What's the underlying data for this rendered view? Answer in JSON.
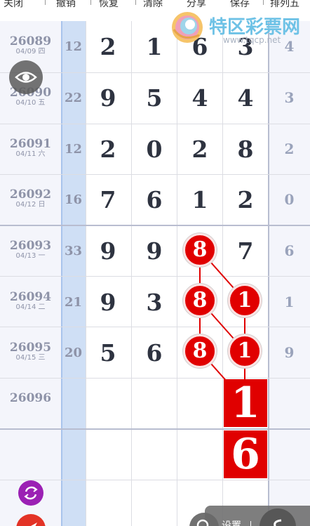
{
  "toolbar": {
    "close": "关闭",
    "undo": "撤销",
    "restore": "恢复",
    "clear": "清除",
    "share": "分享",
    "save": "保存",
    "mode": "排列五"
  },
  "watermark": {
    "brand": "特区彩票网",
    "url": "www.tqcp.net"
  },
  "rows": [
    {
      "issue": "26089",
      "date": "04/09 四",
      "sum": "12",
      "digits": [
        "2",
        "1",
        "6",
        "3"
      ],
      "span": "4"
    },
    {
      "issue": "26090",
      "date": "04/10 五",
      "sum": "22",
      "digits": [
        "9",
        "5",
        "4",
        "4"
      ],
      "span": "3"
    },
    {
      "issue": "26091",
      "date": "04/11 六",
      "sum": "12",
      "digits": [
        "2",
        "0",
        "2",
        "8"
      ],
      "span": "2"
    },
    {
      "issue": "26092",
      "date": "04/12 日",
      "sum": "16",
      "digits": [
        "7",
        "6",
        "1",
        "2"
      ],
      "span": "0"
    },
    {
      "issue": "26093",
      "date": "04/13 一",
      "sum": "33",
      "digits": [
        "9",
        "9",
        "8",
        "7"
      ],
      "span": "6"
    },
    {
      "issue": "26094",
      "date": "04/14 二",
      "sum": "21",
      "digits": [
        "9",
        "3",
        "8",
        "1"
      ],
      "span": "1"
    },
    {
      "issue": "26095",
      "date": "04/15 三",
      "sum": "20",
      "digits": [
        "5",
        "6",
        "8",
        "1"
      ],
      "span": "9"
    },
    {
      "issue": "26096",
      "date": "",
      "sum": "",
      "digits": [
        "",
        "",
        "",
        "1"
      ],
      "span": ""
    },
    {
      "issue": "",
      "date": "",
      "sum": "",
      "digits": [
        "",
        "",
        "",
        "6"
      ],
      "span": ""
    }
  ],
  "controls": {
    "settings_label": "设置"
  },
  "colors": {
    "hit": "#e10000",
    "sum_column": "#cfdff5",
    "issue_column": "#f4f5fb",
    "refresh": "#9b20b4",
    "send": "#e33326"
  },
  "icons": [
    "eye-icon",
    "refresh-icon",
    "send-icon",
    "search-icon",
    "share-icon"
  ]
}
